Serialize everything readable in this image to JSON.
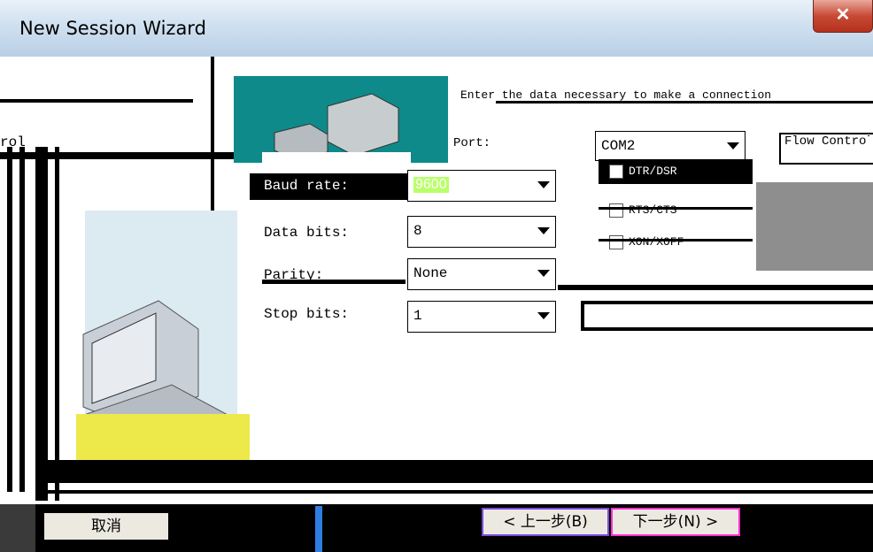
{
  "window": {
    "title": "New Session Wizard"
  },
  "left_panel": {
    "label_fragment": "rol"
  },
  "header": {
    "instruction": "Enter the data necessary to make a connection"
  },
  "fields": {
    "port": {
      "label": "Port:",
      "value": "COM2"
    },
    "flow_control_label": "Flow Control",
    "baud_rate": {
      "label": "Baud rate:",
      "value": "9600"
    },
    "data_bits": {
      "label": "Data bits:",
      "value": "8"
    },
    "parity": {
      "label": "Parity:",
      "value": "None"
    },
    "stop_bits": {
      "label": "Stop bits:",
      "value": "1"
    }
  },
  "flow_control": [
    {
      "label": "DTR/DSR",
      "checked": false
    },
    {
      "label": "RTS/CTS",
      "checked": false
    },
    {
      "label": "XON/XOFF",
      "checked": false
    }
  ],
  "buttons": {
    "cancel": "取消",
    "back": "< 上一步(B)",
    "next": "下一步(N) >"
  },
  "icons": {
    "close": "close-icon",
    "dropdown": "chevron-down-icon"
  },
  "colors": {
    "header_image": "#0e8a8a",
    "selection": "#b9ff6a",
    "title_bar": "#cfe0f0"
  }
}
